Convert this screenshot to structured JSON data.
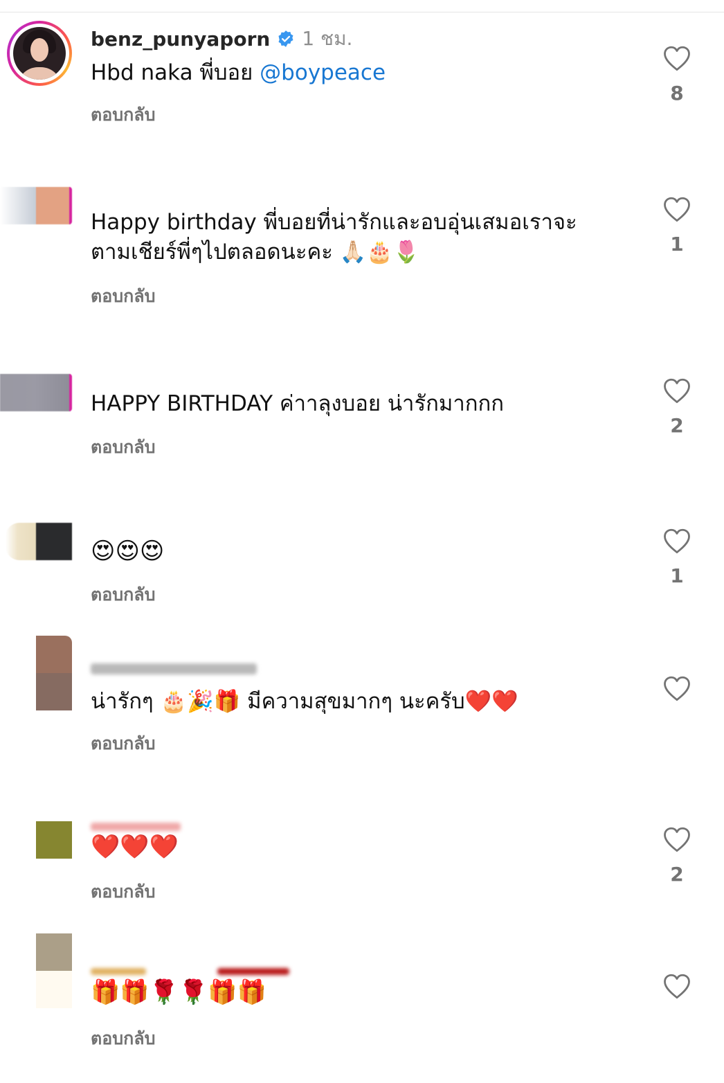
{
  "comments": [
    {
      "username": "benz_punyaporn",
      "time": "1 ชม.",
      "text": "Hbd naka พี่บอย ",
      "mention": "@boypeace",
      "reply_label": "ตอบกลับ",
      "likes": "8"
    },
    {
      "text": "Happy birthday พี่บอยที่น่ารักและอบอุ่นเสมอเราจะ\nตามเชียร์พี่ๆไปตลอดนะคะ 🙏🏻🎂🌷",
      "reply_label": "ตอบกลับ",
      "likes": "1"
    },
    {
      "text": "HAPPY BIRTHDAY ค่าาลุงบอย น่ารักมากกก",
      "reply_label": "ตอบกลับ",
      "likes": "2"
    },
    {
      "text": "😍😍😍",
      "reply_label": "ตอบกลับ",
      "likes": "1"
    },
    {
      "text": "น่ารักๆ 🎂🎉🎁 มีความสุขมากๆ นะครับ❤️❤️",
      "reply_label": "ตอบกลับ",
      "likes": ""
    },
    {
      "text": "❤️❤️❤️",
      "reply_label": "ตอบกลับ",
      "likes": "2"
    },
    {
      "text": "🎁🎁🌹🌹🎁🎁",
      "reply_label": "ตอบกลับ",
      "likes": ""
    }
  ],
  "colors": {
    "mention": "#1877d2",
    "verified": "#3897f0",
    "secondary_text": "#737373"
  },
  "icons": {
    "like": "heart-outline-icon",
    "verified": "verified-badge-icon"
  }
}
